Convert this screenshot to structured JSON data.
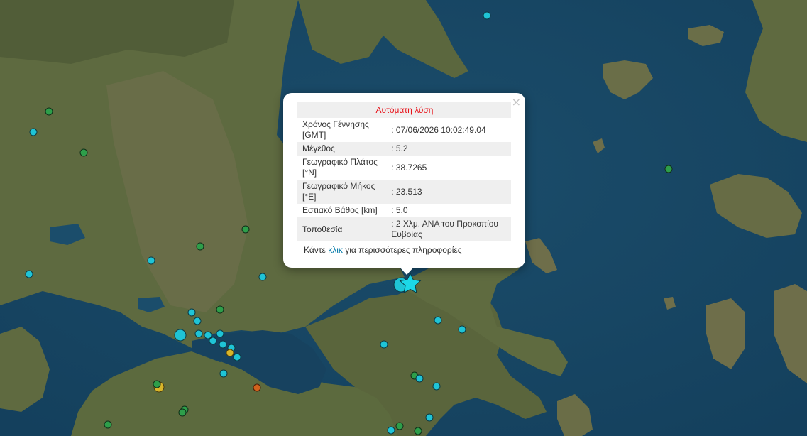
{
  "popup": {
    "close_symbol": "×",
    "header": "Αυτόματη λύση",
    "rows": [
      {
        "label": "Χρόνος Γέννησης [GMT]",
        "value": ": 07/06/2026 10:02:49.04"
      },
      {
        "label": "Μέγεθος",
        "value": ": 5.2"
      },
      {
        "label": "Γεωγραφικό Πλάτος [°N]",
        "value": ": 38.7265"
      },
      {
        "label": "Γεωγραφικό Μήκος [°E]",
        "value": ": 23.513"
      },
      {
        "label": "Εστιακό Βάθος [km]",
        "value": ": 5.0"
      },
      {
        "label": "Τοποθεσία",
        "value": ": 2 Χλμ. ΑΝΑ του Προκοπίου Ευβοίας"
      }
    ],
    "footer_before": "Κάντε ",
    "footer_link": "κλικ",
    "footer_after": " για περισσότερες πληροφορίες"
  },
  "legend_colors": {
    "cyan": "#1fc4d6",
    "green": "#2e9e4a",
    "yellow": "#d8b52a",
    "orange": "#d1621c",
    "star": "#1cd8e8"
  },
  "icons": {
    "latest_event": "star-icon"
  }
}
